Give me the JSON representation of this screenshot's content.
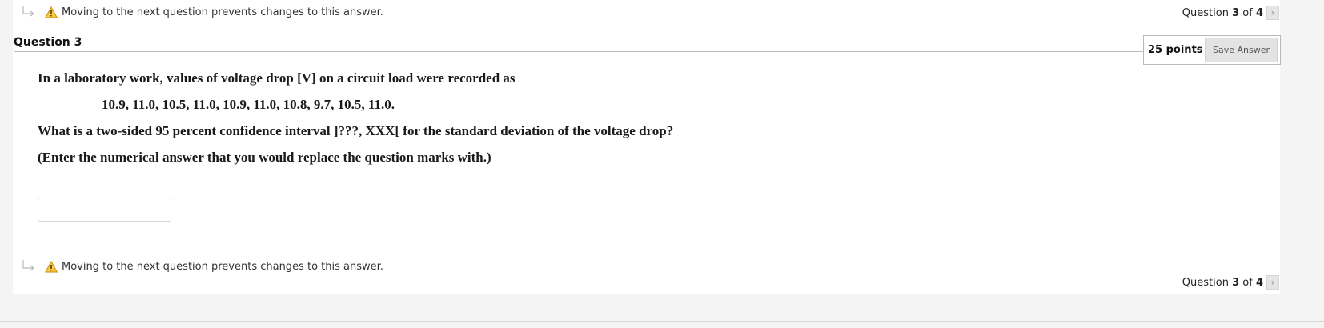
{
  "warning": {
    "text": "Moving to the next question prevents changes to this answer.",
    "icon": "warning-triangle-icon",
    "icon_color": "#e8a000"
  },
  "nav": {
    "prefix": "Question",
    "current": "3",
    "of_word": "of",
    "total": "4",
    "next_icon": "chevron-right-icon"
  },
  "question": {
    "title": "Question 3",
    "points": "25 points",
    "save_label": "Save Answer",
    "lines": [
      "In a laboratory work, values of voltage drop [V] on a circuit load were recorded as",
      "10.9, 11.0, 10.5, 11.0, 10.9, 11.0, 10.8, 9.7, 10.5, 11.0.",
      "What is a two-sided 95 percent confidence interval ]???, XXX[ for the standard deviation of the voltage drop?",
      "(Enter the numerical answer that you would replace the question marks with.)"
    ],
    "answer_value": ""
  }
}
